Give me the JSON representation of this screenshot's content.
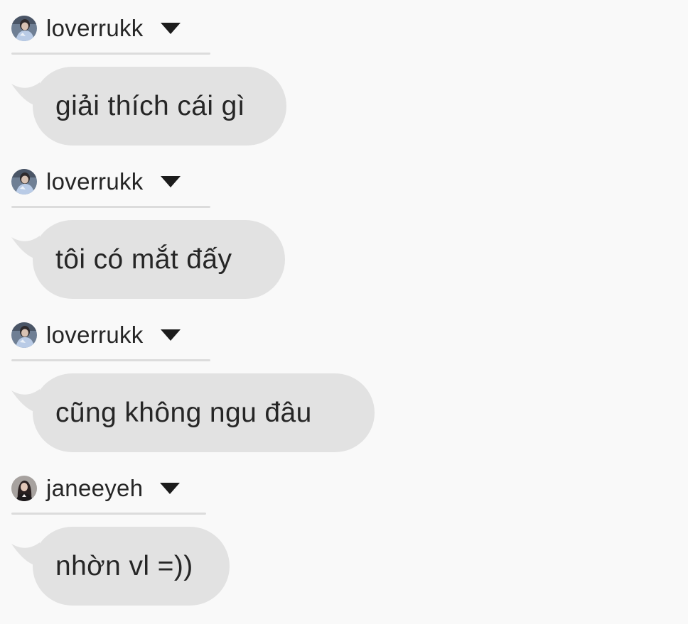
{
  "conversation": {
    "messages": [
      {
        "username": "loverrukk",
        "avatar_icon": "user-avatar-photo",
        "dropdown_icon": "caret-down-icon",
        "text": "giải thích cái gì"
      },
      {
        "username": "loverrukk",
        "avatar_icon": "user-avatar-photo",
        "dropdown_icon": "caret-down-icon",
        "text": "tôi có mắt đấy"
      },
      {
        "username": "loverrukk",
        "avatar_icon": "user-avatar-photo",
        "dropdown_icon": "caret-down-icon",
        "text": "cũng không ngu đâu"
      },
      {
        "username": "janeeyeh",
        "avatar_icon": "user-avatar-photo",
        "dropdown_icon": "caret-down-icon",
        "text": "nhờn vl =))"
      }
    ]
  },
  "colors": {
    "background": "#f9f9f9",
    "bubble": "#e2e2e2",
    "divider": "#dcdcdc",
    "text": "#262626"
  }
}
